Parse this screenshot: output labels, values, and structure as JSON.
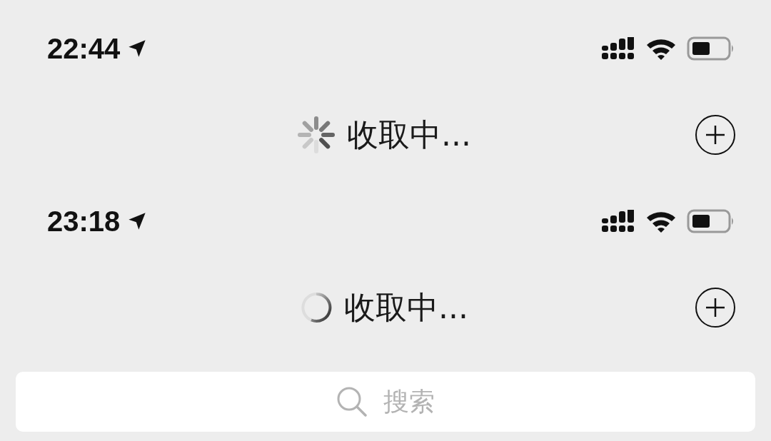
{
  "panels": [
    {
      "status_bar": {
        "time": "22:44"
      },
      "header": {
        "spinner": {
          "kind": "spokes"
        },
        "title": "收取中..."
      }
    },
    {
      "status_bar": {
        "time": "23:18"
      },
      "header": {
        "spinner": {
          "kind": "ring"
        },
        "title": "收取中..."
      }
    }
  ],
  "search": {
    "placeholder": "搜索"
  }
}
